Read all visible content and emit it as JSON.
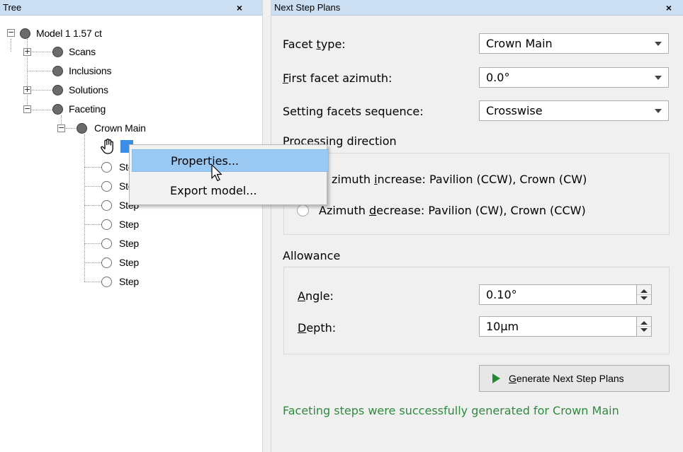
{
  "tree": {
    "title": "Tree",
    "close": "×",
    "nodes": {
      "model": "Model 1 1.57 ct",
      "scans": "Scans",
      "inclusions": "Inclusions",
      "solutions": "Solutions",
      "faceting": "Faceting",
      "crown_main": "Crown Main",
      "step_label": "Step"
    },
    "expanders": {
      "plus": "+",
      "minus": "−"
    }
  },
  "context_menu": {
    "items": [
      "Properties...",
      "Export model..."
    ]
  },
  "plans": {
    "title": "Next Step Plans",
    "close": "×",
    "facet_type": {
      "label_pre": "Facet ",
      "label_u": "t",
      "label_post": "ype:",
      "value": "Crown Main"
    },
    "first_facet_azimuth": {
      "label_u": "F",
      "label_post": "irst facet azimuth:",
      "value": "0.0°"
    },
    "setting_sequence": {
      "label": "Setting facets sequence:",
      "value": "Crosswise"
    },
    "processing_direction": {
      "label": "Processing direction",
      "options": [
        {
          "pre": "zimuth ",
          "u": "i",
          "post": "ncrease: Pavilion (CCW), Crown (CW)"
        },
        {
          "pre": "Azimuth ",
          "u": "d",
          "post": "ecrease: Pavilion (CW), Crown (CCW)"
        }
      ]
    },
    "allowance": {
      "label": "Allowance",
      "angle": {
        "label_u": "A",
        "label_post": "ngle:",
        "value": "0.10°"
      },
      "depth": {
        "label_u": "D",
        "label_post": "epth:",
        "value": "10μm"
      }
    },
    "generate_button": {
      "u": "G",
      "post": "enerate Next Step Plans"
    },
    "status": "Faceting steps were successfully generated for Crown Main"
  },
  "colors": {
    "title_bar": "#ccdef2",
    "menu_highlight": "#99c9f3",
    "status_green": "#2e8b3e",
    "play_green": "#1f8a32"
  },
  "icons": {
    "cursor_hand": "hand-pointer-icon",
    "cursor_arrow": "arrow-cursor-icon",
    "play": "play-icon"
  }
}
